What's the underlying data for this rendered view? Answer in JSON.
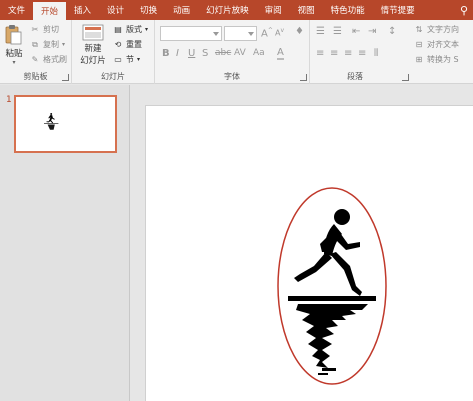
{
  "ribbon_tabs": [
    {
      "label": "文件",
      "active": false
    },
    {
      "label": "开始",
      "active": true
    },
    {
      "label": "插入",
      "active": false
    },
    {
      "label": "设计",
      "active": false
    },
    {
      "label": "切换",
      "active": false
    },
    {
      "label": "动画",
      "active": false
    },
    {
      "label": "幻灯片放映",
      "active": false
    },
    {
      "label": "审阅",
      "active": false
    },
    {
      "label": "视图",
      "active": false
    },
    {
      "label": "特色功能",
      "active": false
    },
    {
      "label": "情节提要",
      "active": false
    }
  ],
  "clipboard": {
    "paste_label": "粘贴",
    "cut_label": "剪切",
    "copy_label": "复制",
    "format_painter_label": "格式刷",
    "group_label": "剪贴板"
  },
  "slides_group": {
    "new_slide_label_1": "新建",
    "new_slide_label_2": "幻灯片",
    "layout_label": "版式",
    "reset_label": "重置",
    "section_label": "节",
    "group_label": "幻灯片"
  },
  "font_group": {
    "font_name_value": "",
    "font_size_value": "",
    "group_label": "字体"
  },
  "paragraph_group": {
    "text_direction_label": "文字方向",
    "align_text_label": "对齐文本",
    "convert_label": "转换为 S",
    "group_label": "段落"
  },
  "thumbnails": [
    {
      "number": "1",
      "selected": true
    }
  ],
  "colors": {
    "accent": "#b7472a",
    "ellipse_stroke": "#c0392b",
    "silhouette": "#000000"
  }
}
